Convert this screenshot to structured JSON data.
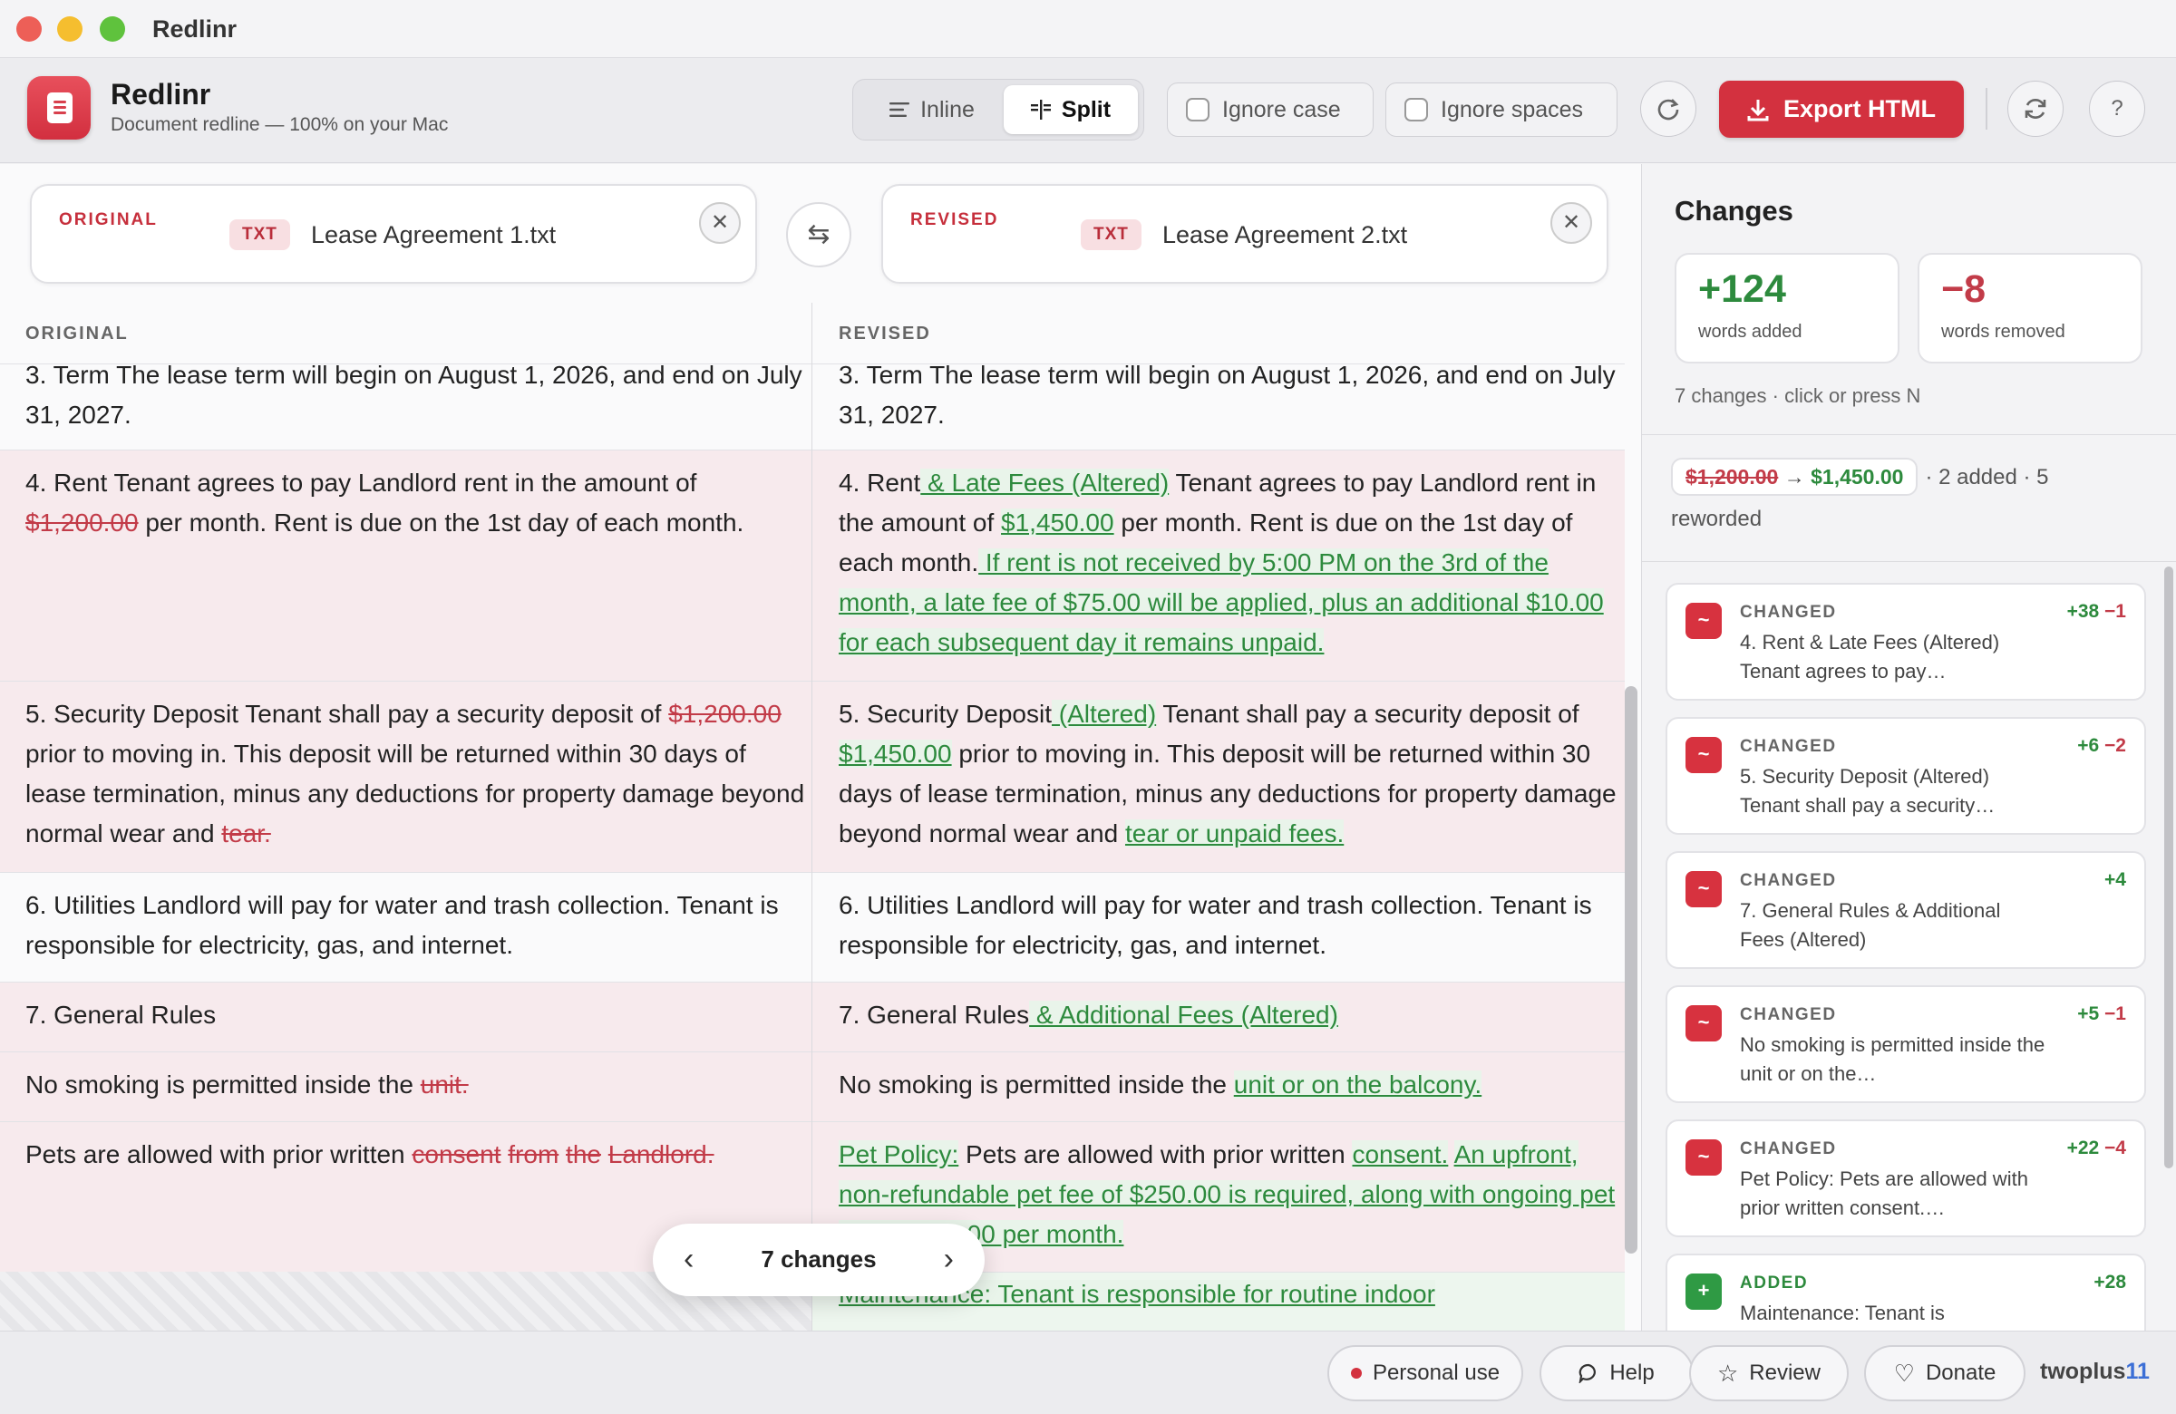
{
  "window": {
    "title": "Redlinr"
  },
  "app": {
    "name": "Redlinr",
    "subtitle": "Document redline — 100% on your Mac"
  },
  "toolbar": {
    "view_inline": "Inline",
    "view_split": "Split",
    "active_view": "Split",
    "ignore_case": "Ignore case",
    "ignore_spaces": "Ignore spaces",
    "export_label": "Export HTML",
    "help_label": "?"
  },
  "files": {
    "original": {
      "label": "ORIGINAL",
      "type": "TXT",
      "name": "Lease Agreement 1.txt"
    },
    "revised": {
      "label": "REVISED",
      "type": "TXT",
      "name": "Lease Agreement 2.txt"
    }
  },
  "columns": {
    "left": "ORIGINAL",
    "right": "REVISED"
  },
  "diff": {
    "r1": {
      "l": "3. Term The lease term will begin on August 1, 2026, and end on July 31, 2027.",
      "r": "3. Term The lease term will begin on August 1, 2026, and end on July 31, 2027."
    },
    "r2": {
      "l1": "4. Rent Tenant agrees to pay Landlord rent in the amount of ",
      "ldel": "$1,200.00",
      "l2": " per month. Rent is due on the 1st day of each month.",
      "r1": "4. Rent",
      "radd1": " & Late Fees (Altered)",
      "r2": " Tenant agrees to pay Landlord rent in the amount of ",
      "radd2": "$1,450.00",
      "r3": " per month. Rent is due on the 1st day of each month.",
      "radd3": " If rent is not received by 5:00 PM on the 3rd of the month, a late fee of $75.00 will be applied, plus an additional $10.00 for each subsequent day it remains unpaid."
    },
    "r3": {
      "l1": "5. Security Deposit Tenant shall pay a security deposit of ",
      "ldel1": "$1,200.00",
      "l2": " prior to moving in. This deposit will be returned within 30 days of lease termination, minus any deductions for property damage beyond normal wear and ",
      "ldel2": "tear.",
      "r1": "5. Security Deposit",
      "radd1": " (Altered)",
      "r2": " Tenant shall pay a security deposit of ",
      "radd2": "$1,450.00",
      "r3": " prior to moving in. This deposit will be returned within 30 days of lease termination, minus any deductions for property damage beyond normal wear and ",
      "radd3": "tear or unpaid fees."
    },
    "r4": {
      "l": "6. Utilities Landlord will pay for water and trash collection. Tenant is responsible for electricity, gas, and internet.",
      "r": "6. Utilities Landlord will pay for water and trash collection. Tenant is responsible for electricity, gas, and internet."
    },
    "r5": {
      "l": "7. General Rules",
      "r1": "7. General Rules",
      "radd": " & Additional Fees (Altered)"
    },
    "r6": {
      "l1": "No smoking is permitted inside the ",
      "ldel": "unit.",
      "r1": "No smoking is permitted inside the ",
      "radd": "unit or on the balcony."
    },
    "r7": {
      "l1": "Pets are allowed with prior written ",
      "ldel1": "consent",
      "ldel2": "from",
      "ldel3": "the",
      "ldel4": "Landlord.",
      "radd1": "Pet Policy:",
      "r1": " Pets are allowed with prior written ",
      "radd2": "consent.",
      "radd3": "An upfront,",
      "radd4": "non-refundable pet fee of $250.00 is required, along with ongoing pet rent of $50.00 per month."
    },
    "r8": {
      "radd": "Maintenance: Tenant is responsible for routine indoor"
    }
  },
  "pager": {
    "count": "7 changes"
  },
  "sidebar": {
    "title": "Changes",
    "added": {
      "value": "+124",
      "label": "words added"
    },
    "removed": {
      "value": "−8",
      "label": "words removed"
    },
    "hint": "7 changes · click or press N",
    "summary": {
      "old": "$1,200.00",
      "new": "$1,450.00",
      "rest": "· 2 added · 5 reworded"
    },
    "cards": [
      {
        "kind": "CHANGED",
        "icon": "~",
        "plus": "+38",
        "minus": "−1",
        "desc": "4. Rent & Late Fees (Altered) Tenant agrees to pay…"
      },
      {
        "kind": "CHANGED",
        "icon": "~",
        "plus": "+6",
        "minus": "−2",
        "desc": "5. Security Deposit (Altered) Tenant shall pay a security…"
      },
      {
        "kind": "CHANGED",
        "icon": "~",
        "plus": "+4",
        "minus": "",
        "desc": "7. General Rules & Additional Fees (Altered)"
      },
      {
        "kind": "CHANGED",
        "icon": "~",
        "plus": "+5",
        "minus": "−1",
        "desc": "No smoking is permitted inside the unit or on the…"
      },
      {
        "kind": "CHANGED",
        "icon": "~",
        "plus": "+22",
        "minus": "−4",
        "desc": "Pet Policy: Pets are allowed with prior written consent.…"
      },
      {
        "kind": "ADDED",
        "icon": "+",
        "plus": "+28",
        "minus": "",
        "desc": "Maintenance: Tenant is"
      }
    ]
  },
  "footer": {
    "personal": "Personal use",
    "help": "Help",
    "review": "Review",
    "donate": "Donate",
    "brand_a": "twoplus",
    "brand_b": "11"
  },
  "colors": {
    "accent": "#d3313f",
    "added": "#2d8a3d",
    "removed": "#c23b48",
    "changed_row": "#f7eaed"
  }
}
